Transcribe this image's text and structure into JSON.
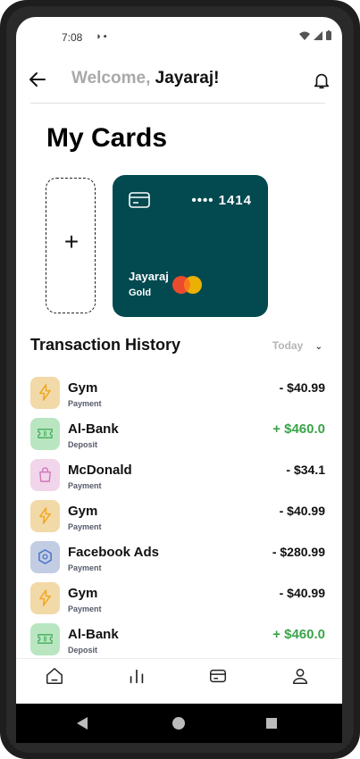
{
  "status_bar": {
    "time": "7:08"
  },
  "header": {
    "welcome_prefix": "Welcome,",
    "user_name": "Jayaraj!"
  },
  "page_title": "My Cards",
  "card": {
    "masked": "••••",
    "last4": "1414",
    "holder": "Jayaraj",
    "tier": "Gold",
    "color": "#024950"
  },
  "add_card_label": "+",
  "history": {
    "title": "Transaction History",
    "filter": "Today",
    "transactions": [
      {
        "name": "Gym",
        "type": "Payment",
        "amount": "- $40.99",
        "icon": "bolt-icon"
      },
      {
        "name": "Al-Bank",
        "type": "Deposit",
        "amount": "+ $460.0",
        "icon": "ticket-icon"
      },
      {
        "name": "McDonald",
        "type": "Payment",
        "amount": "- $34.1",
        "icon": "bag-icon"
      },
      {
        "name": "Gym",
        "type": "Payment",
        "amount": "- $40.99",
        "icon": "bolt-icon"
      },
      {
        "name": "Facebook Ads",
        "type": "Payment",
        "amount": "- $280.99",
        "icon": "hexagon-icon"
      },
      {
        "name": "Gym",
        "type": "Payment",
        "amount": "- $40.99",
        "icon": "bolt-icon"
      },
      {
        "name": "Al-Bank",
        "type": "Deposit",
        "amount": "+ $460.0",
        "icon": "ticket-icon"
      }
    ]
  },
  "bottom_nav": [
    "home-icon",
    "chart-icon",
    "card-icon",
    "profile-icon"
  ],
  "colors": {
    "positive": "#3aa34a",
    "card_bg": "#024950"
  }
}
